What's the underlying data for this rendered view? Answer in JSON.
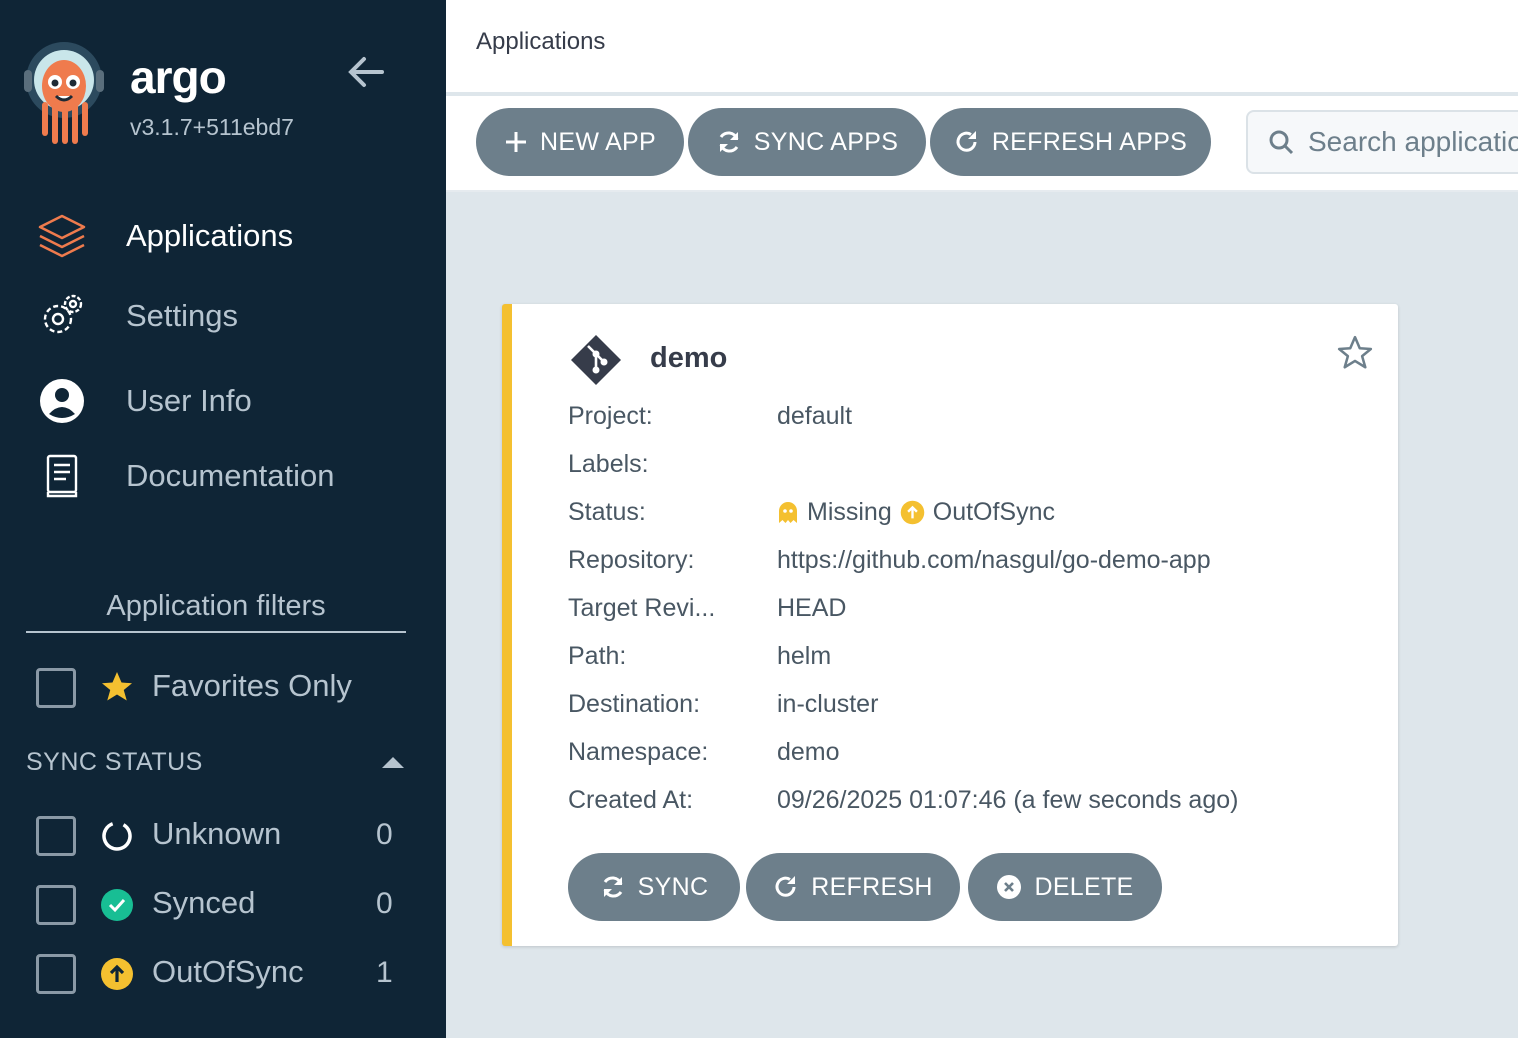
{
  "app": {
    "brand": "argo",
    "version": "v3.1.7+511ebd7"
  },
  "nav": [
    {
      "label": "Applications",
      "icon": "layers-icon",
      "active": true
    },
    {
      "label": "Settings",
      "icon": "gears-icon",
      "active": false
    },
    {
      "label": "User Info",
      "icon": "user-circle-icon",
      "active": false
    },
    {
      "label": "Documentation",
      "icon": "book-icon",
      "active": false
    }
  ],
  "filters": {
    "title": "Application filters",
    "favorites_label": "Favorites Only",
    "sync_status_title": "SYNC STATUS",
    "sync_status": [
      {
        "label": "Unknown",
        "count": "0",
        "icon": "circle-notch-icon"
      },
      {
        "label": "Synced",
        "count": "0",
        "icon": "check-circle-icon",
        "color": "#18be94"
      },
      {
        "label": "OutOfSync",
        "count": "1",
        "icon": "arrow-up-circle-icon",
        "color": "#f4c030"
      }
    ]
  },
  "header": {
    "title": "Applications"
  },
  "toolbar": {
    "new_app": "NEW APP",
    "sync_apps": "SYNC APPS",
    "refresh_apps": "REFRESH APPS",
    "search_placeholder": "Search applications..."
  },
  "card": {
    "name": "demo",
    "status_color": "#f4c030",
    "fields": {
      "project_label": "Project:",
      "project": "default",
      "labels_label": "Labels:",
      "labels": "",
      "status_label": "Status:",
      "health": "Missing",
      "sync": "OutOfSync",
      "repo_label": "Repository:",
      "repo": "https://github.com/nasgul/go-demo-app",
      "target_label": "Target Revi...",
      "target": "HEAD",
      "path_label": "Path:",
      "path": "helm",
      "dest_label": "Destination:",
      "dest": "in-cluster",
      "ns_label": "Namespace:",
      "ns": "demo",
      "created_label": "Created At:",
      "created": "09/26/2025 01:07:46  (a few seconds ago)"
    },
    "actions": {
      "sync": "SYNC",
      "refresh": "REFRESH",
      "delete": "DELETE"
    }
  },
  "colors": {
    "sidebar": "#0f2536",
    "button": "#6d7f8b",
    "accent": "#f4c030",
    "synced": "#18be94"
  }
}
